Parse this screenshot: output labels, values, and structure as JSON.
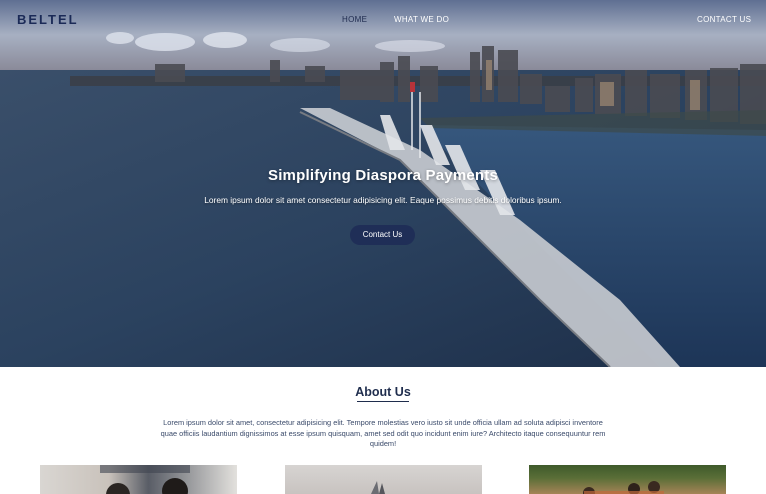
{
  "brand": {
    "name": "BELTEL"
  },
  "nav": {
    "home": "HOME",
    "what_we_do": "WHAT WE DO",
    "contact": "CONTACT US"
  },
  "hero": {
    "title": "Simplifying Diaspora Payments",
    "text": "Lorem ipsum dolor sit amet consectetur adipisicing elit. Eaque possimus debitis doloribus ipsum.",
    "button_label": "Contact Us"
  },
  "about": {
    "title": "About Us",
    "text": "Lorem ipsum dolor sit amet, consectetur adipisicing elit. Tempore molestias vero iusto sit unde officia ullam ad soluta adipisci inventore quae officiis laudantium dignissimos at esse ipsum quisquam, amet sed odit quo incidunt enim iure? Architecto itaque consequuntur rem quidem!"
  },
  "colors": {
    "brand_navy": "#1f2e57",
    "text_dark": "#1f2d4d"
  }
}
